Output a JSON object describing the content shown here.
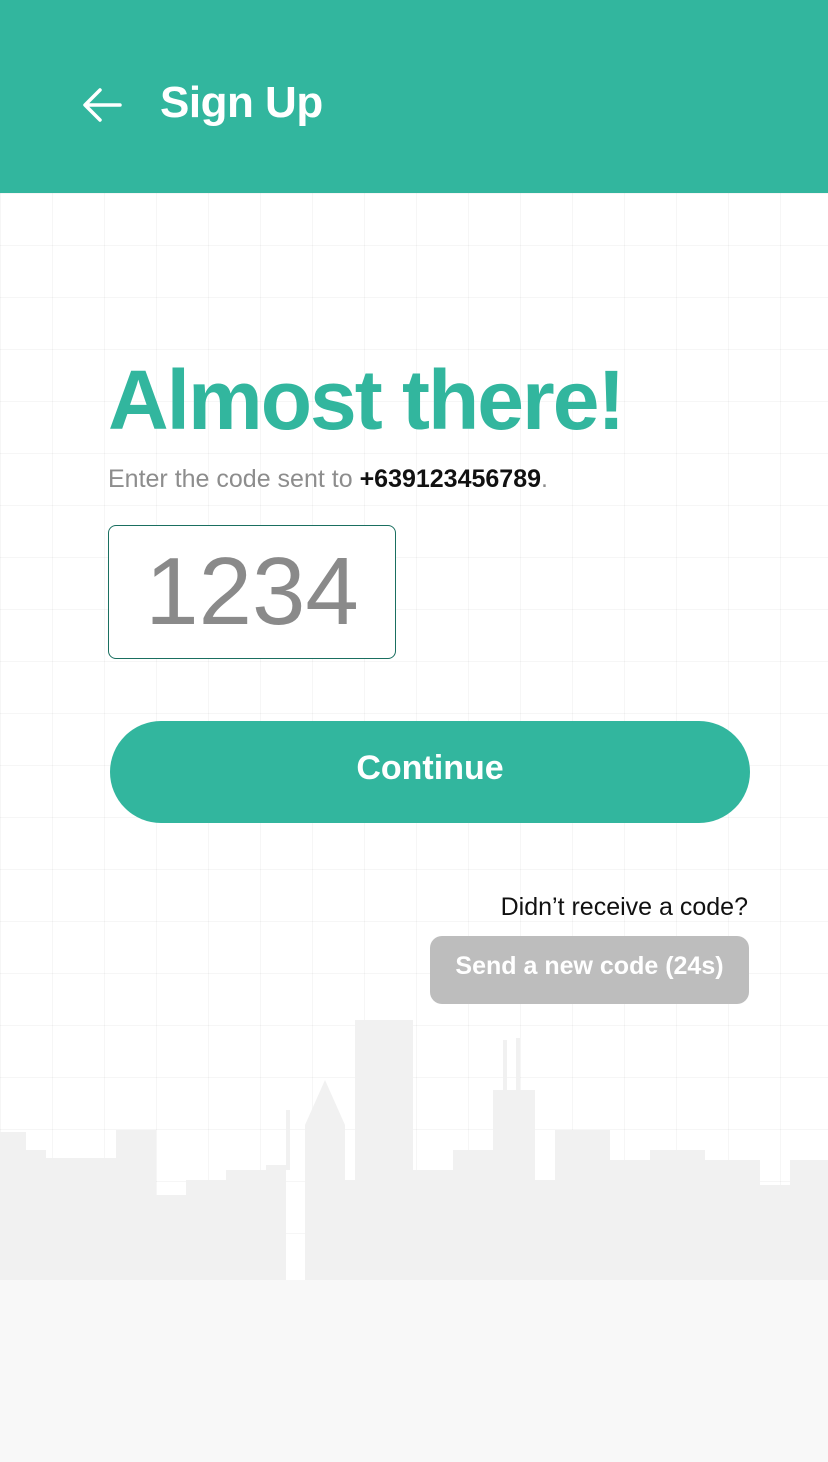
{
  "header": {
    "back_icon": "arrow-left-icon",
    "title": "Sign Up",
    "background_color": "#32b69e"
  },
  "main": {
    "headline": "Almost there!",
    "instruction_prefix": "Enter the code sent to ",
    "phone_number": "+639123456789",
    "instruction_suffix": ".",
    "code_field": {
      "placeholder": "1234",
      "value": ""
    },
    "continue_label": "Continue",
    "resend_prompt": "Didn’t receive a code?",
    "resend_label": "Send a new code (24s)"
  },
  "colors": {
    "accent": "#32b69e",
    "disabled_button": "#bdbdbd",
    "input_border": "#1a6f60"
  }
}
